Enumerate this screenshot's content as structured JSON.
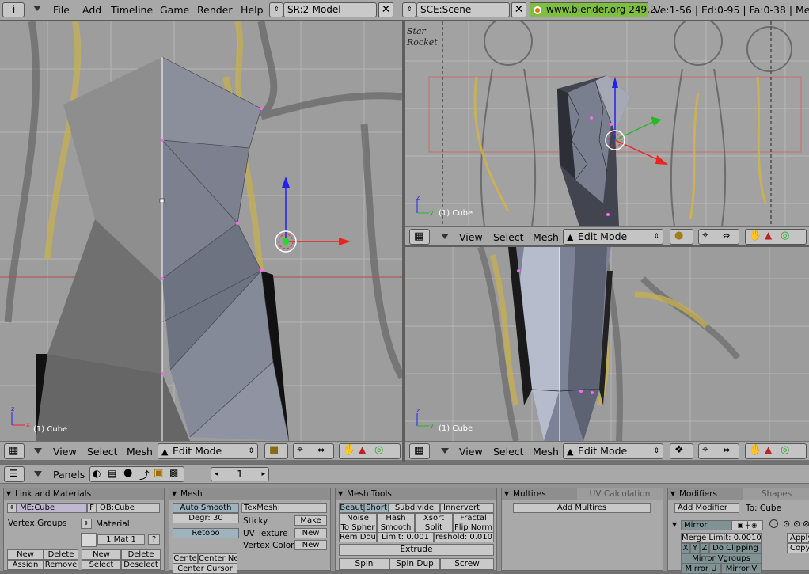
{
  "topbar": {
    "menus": [
      "File",
      "Add",
      "Timeline",
      "Game",
      "Render",
      "Help"
    ],
    "screen_field": "SR:2-Model",
    "scene_field": "SCE:Scene",
    "website": "www.blender.org 249.2",
    "stats": "Ve:1-56 | Ed:0-95 | Fa:0-38 | Me"
  },
  "viewports": {
    "left": {
      "label": "(1) Cube",
      "menus": [
        "View",
        "Select",
        "Mesh"
      ],
      "mode": "Edit Mode"
    },
    "right_top": {
      "label": "(1) Cube",
      "menus": [
        "View",
        "Select",
        "Mesh"
      ],
      "mode": "Edit Mode",
      "sketch_text": "Star\nRocket"
    },
    "right_bottom": {
      "label": "(1) Cube",
      "menus": [
        "View",
        "Select",
        "Mesh"
      ],
      "mode": "Edit Mode"
    }
  },
  "buttons_header": {
    "panels_label": "Panels",
    "frame": "1"
  },
  "panels": {
    "link_materials": {
      "title": "Link and Materials",
      "me_field": "ME:Cube",
      "f_btn": "F",
      "ob_field": "OB:Cube",
      "vertex_groups": "Vertex Groups",
      "material": "Material",
      "mat_field": "1 Mat 1",
      "question": "?",
      "new1": "New",
      "delete1": "Delete",
      "assign": "Assign",
      "remove": "Remove",
      "new2": "New",
      "delete2": "Delete",
      "select": "Select",
      "deselect": "Deselect"
    },
    "mesh": {
      "title": "Mesh",
      "auto_smooth": "Auto Smooth",
      "degr": "Degr: 30",
      "retopo": "Retopo",
      "texmesh": "TexMesh:",
      "sticky": "Sticky",
      "make": "Make",
      "uv_texture": "UV Texture",
      "new_uv": "New",
      "vertex_color": "Vertex Color",
      "new_vc": "New",
      "center": "Cente",
      "center_new": "Center Ne",
      "center_cursor": "Center Cursor"
    },
    "mesh_tools": {
      "title": "Mesh Tools",
      "beaut": "Beaut",
      "short": "Short",
      "subdivide": "Subdivide",
      "innervert": "Innervert",
      "noise": "Noise",
      "hash": "Hash",
      "xsort": "Xsort",
      "fractal": "Fractal",
      "to_sphere": "To Spher",
      "smooth": "Smooth",
      "split": "Split",
      "flip_norm": "Flip Norm",
      "rem_dou": "Rem Dou",
      "limit": "Limit: 0.001",
      "threshold": "reshold: 0.010",
      "extrude": "Extrude",
      "spin": "Spin",
      "spin_dup": "Spin Dup",
      "screw": "Screw"
    },
    "multires": {
      "title": "Multires",
      "tab2": "UV Calculation",
      "add": "Add Multires"
    },
    "modifiers": {
      "title": "Modifiers",
      "tab2": "Shapes",
      "add_modifier": "Add Modifier",
      "to": "To: Cube",
      "mirror": "Mirror",
      "merge_limit": "Merge Limit: 0.0010",
      "x": "X",
      "y": "Y",
      "z": "Z",
      "do_clipping": "Do Clipping",
      "mirror_vgroups": "Mirror Vgroups",
      "mirror_u": "Mirror U",
      "mirror_v": "Mirror V",
      "apply": "Apply",
      "copy": "Copy"
    }
  },
  "colors": {
    "header": "#a8a8a8",
    "panel": "#a9a9a9",
    "viewport": "#9a9a9a",
    "accent_green": "#7fbf3f"
  }
}
